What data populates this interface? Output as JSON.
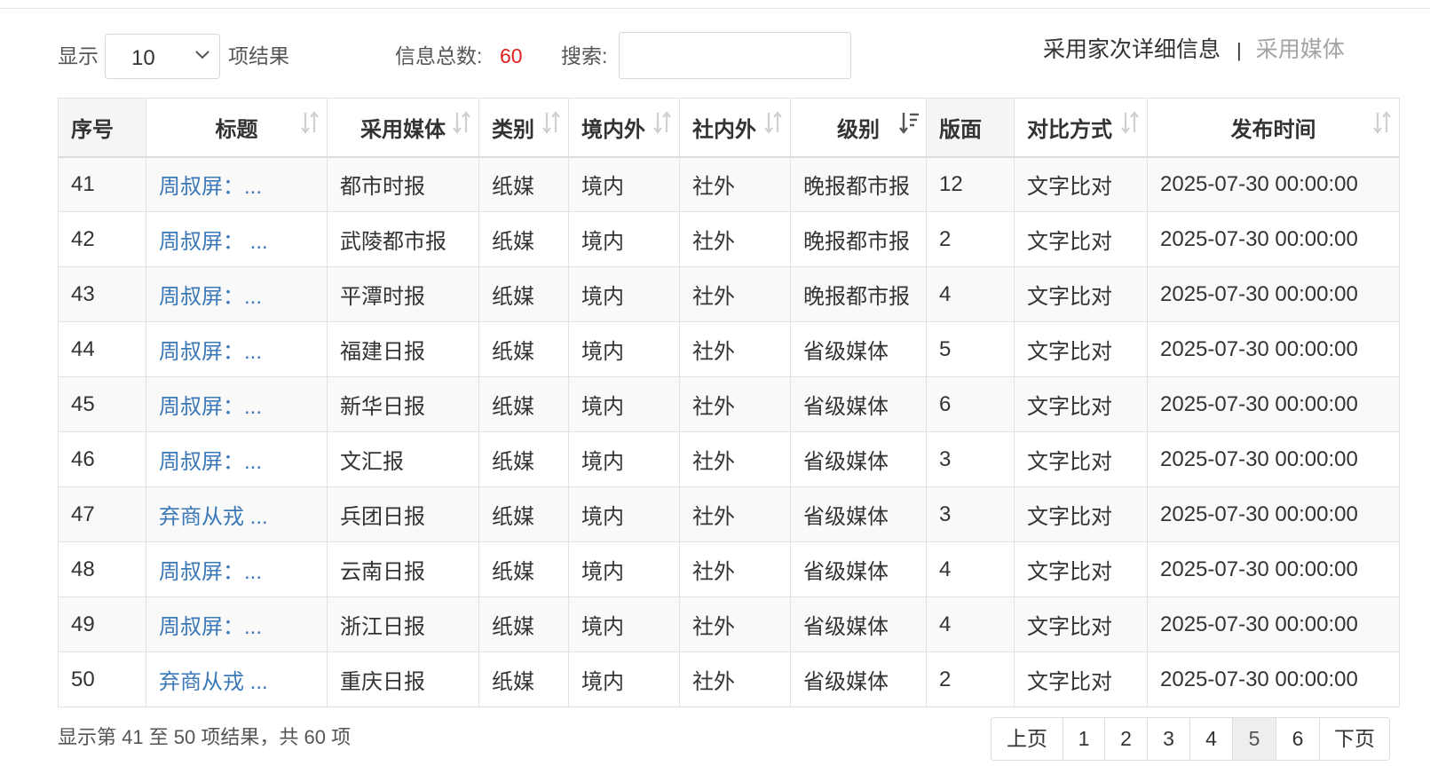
{
  "toolbar": {
    "show_prefix": "显示",
    "page_size": "10",
    "show_suffix": "项结果",
    "total_label": "信息总数:",
    "total_value": "60",
    "search_label": "搜索:",
    "search_value": "",
    "search_placeholder": ""
  },
  "tabs": {
    "active": "采用家次详细信息",
    "separator": "|",
    "inactive": "采用媒体"
  },
  "table": {
    "columns": [
      "序号",
      "标题",
      "采用媒体",
      "类别",
      "境内外",
      "社内外",
      "级别",
      "版面",
      "对比方式",
      "发布时间"
    ],
    "rows": [
      [
        "41",
        "周叔屏：...",
        "都市时报",
        "纸媒",
        "境内",
        "社外",
        "晚报都市报",
        "12",
        "文字比对",
        "2025-07-30 00:00:00"
      ],
      [
        "42",
        "周叔屏： ...",
        "武陵都市报",
        "纸媒",
        "境内",
        "社外",
        "晚报都市报",
        "2",
        "文字比对",
        "2025-07-30 00:00:00"
      ],
      [
        "43",
        "周叔屏：...",
        "平潭时报",
        "纸媒",
        "境内",
        "社外",
        "晚报都市报",
        "4",
        "文字比对",
        "2025-07-30 00:00:00"
      ],
      [
        "44",
        "周叔屏：...",
        "福建日报",
        "纸媒",
        "境内",
        "社外",
        "省级媒体",
        "5",
        "文字比对",
        "2025-07-30 00:00:00"
      ],
      [
        "45",
        "周叔屏：...",
        "新华日报",
        "纸媒",
        "境内",
        "社外",
        "省级媒体",
        "6",
        "文字比对",
        "2025-07-30 00:00:00"
      ],
      [
        "46",
        "周叔屏：...",
        "文汇报",
        "纸媒",
        "境内",
        "社外",
        "省级媒体",
        "3",
        "文字比对",
        "2025-07-30 00:00:00"
      ],
      [
        "47",
        "弃商从戎 ...",
        "兵团日报",
        "纸媒",
        "境内",
        "社外",
        "省级媒体",
        "3",
        "文字比对",
        "2025-07-30 00:00:00"
      ],
      [
        "48",
        "周叔屏：...",
        "云南日报",
        "纸媒",
        "境内",
        "社外",
        "省级媒体",
        "4",
        "文字比对",
        "2025-07-30 00:00:00"
      ],
      [
        "49",
        "周叔屏：...",
        "浙江日报",
        "纸媒",
        "境内",
        "社外",
        "省级媒体",
        "4",
        "文字比对",
        "2025-07-30 00:00:00"
      ],
      [
        "50",
        "弃商从戎 ...",
        "重庆日报",
        "纸媒",
        "境内",
        "社外",
        "省级媒体",
        "2",
        "文字比对",
        "2025-07-30 00:00:00"
      ]
    ]
  },
  "footer": {
    "info": "显示第 41 至 50 项结果，共 60 项"
  },
  "pagination": {
    "prev": "上页",
    "pages": [
      "1",
      "2",
      "3",
      "4",
      "5",
      "6"
    ],
    "current": "5",
    "next": "下页"
  },
  "colors": {
    "link": "#3a78b7",
    "count": "#e0201f",
    "border": "#e2e2e2",
    "stripe": "#f9f9f9"
  },
  "icons": {
    "select_arrow": "chevron-down-icon",
    "sortable": "sort-icon",
    "sorted_desc": "sort-desc-icon"
  }
}
